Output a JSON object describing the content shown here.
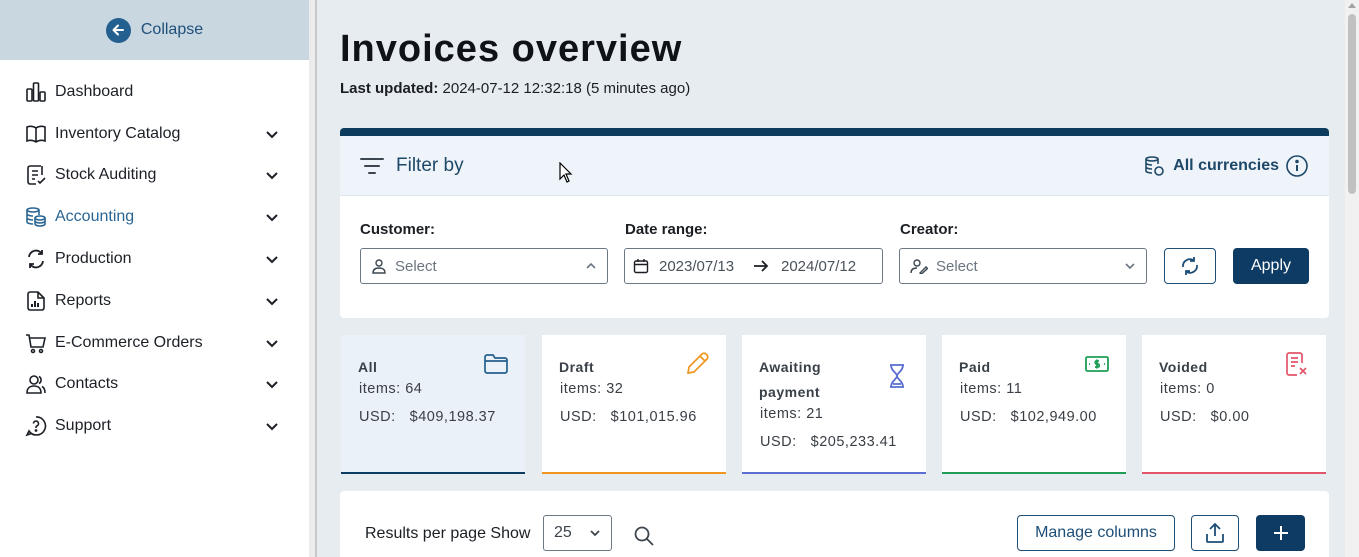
{
  "sidebar": {
    "collapse_label": "Collapse",
    "items": [
      {
        "label": "Dashboard",
        "icon": "dashboard-icon",
        "has_chevron": false
      },
      {
        "label": "Inventory Catalog",
        "icon": "book-icon",
        "has_chevron": true
      },
      {
        "label": "Stock Auditing",
        "icon": "clipboard-check-icon",
        "has_chevron": true
      },
      {
        "label": "Accounting",
        "icon": "coins-icon",
        "has_chevron": true,
        "active": true
      },
      {
        "label": "Production",
        "icon": "cycle-icon",
        "has_chevron": true
      },
      {
        "label": "Reports",
        "icon": "report-icon",
        "has_chevron": true
      },
      {
        "label": "E-Commerce Orders",
        "icon": "cart-icon",
        "has_chevron": true
      },
      {
        "label": "Contacts",
        "icon": "people-icon",
        "has_chevron": true
      },
      {
        "label": "Support",
        "icon": "help-icon",
        "has_chevron": true
      }
    ]
  },
  "page": {
    "title": "Invoices overview",
    "last_updated_label": "Last updated:",
    "last_updated_value": "2024-07-12 12:32:18 (5 minutes ago)"
  },
  "filter": {
    "title": "Filter by",
    "currencies_label": "All currencies",
    "customer_label": "Customer:",
    "customer_placeholder": "Select",
    "date_label": "Date range:",
    "date_from": "2023/07/13",
    "date_to": "2024/07/12",
    "creator_label": "Creator:",
    "creator_placeholder": "Select",
    "apply_label": "Apply"
  },
  "status_cards": [
    {
      "name": "All",
      "items_label": "items: 64",
      "currency": "USD:",
      "amount": "$409,198.37",
      "accent": "#0d3b63",
      "icon": "folder-icon"
    },
    {
      "name": "Draft",
      "items_label": "items: 32",
      "currency": "USD:",
      "amount": "$101,015.96",
      "accent": "#f0951f",
      "icon": "pencil-icon"
    },
    {
      "name_line1": "Awaiting",
      "name_line2": "payment",
      "items_label": "items: 21",
      "currency": "USD:",
      "amount": "$205,233.41",
      "accent": "#5a6fd1",
      "icon": "hourglass-icon"
    },
    {
      "name": "Paid",
      "items_label": "items: 11",
      "currency": "USD:",
      "amount": "$102,949.00",
      "accent": "#1f9d55",
      "icon": "money-icon"
    },
    {
      "name": "Voided",
      "items_label": "items: 0",
      "currency": "USD:",
      "amount": "$0.00",
      "accent": "#e2556a",
      "icon": "voided-receipt-icon"
    }
  ],
  "results": {
    "per_page_label": "Results per page Show",
    "per_page_value": "25",
    "manage_columns_label": "Manage columns"
  }
}
